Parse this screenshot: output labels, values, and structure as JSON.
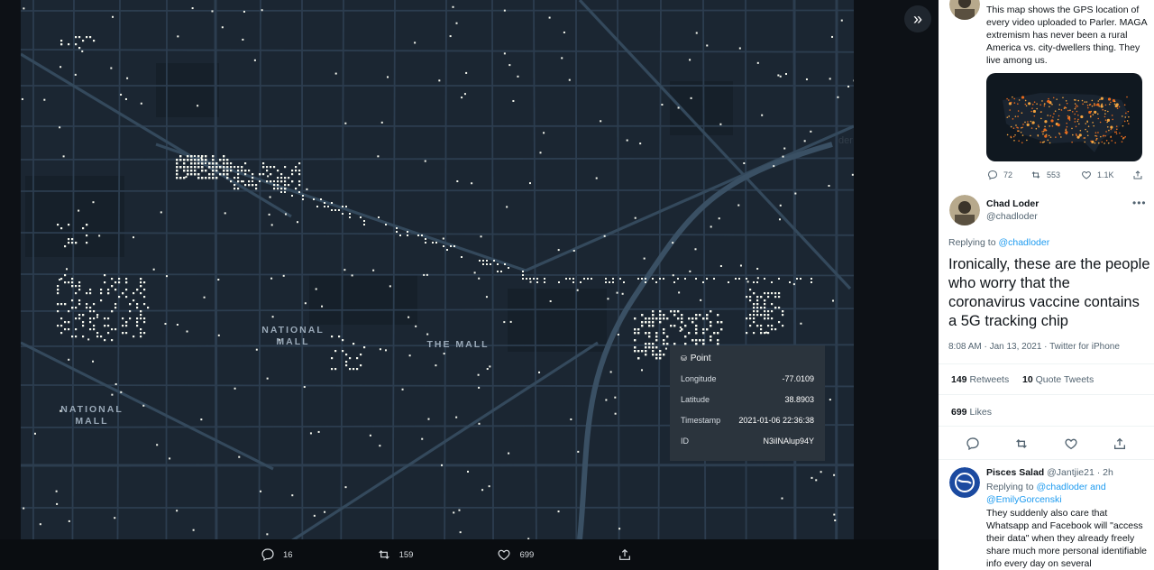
{
  "viewer": {
    "map_labels": [
      {
        "text": "NATIONAL\nMALL"
      },
      {
        "text": "THE MALL"
      },
      {
        "text": "NATIONAL\nMALL"
      }
    ],
    "popup": {
      "title": "Point",
      "rows": [
        {
          "label": "Longitude",
          "value": "-77.0109"
        },
        {
          "label": "Latitude",
          "value": "38.8903"
        },
        {
          "label": "Timestamp",
          "value": "2021-01-06 22:36:38"
        },
        {
          "label": "ID",
          "value": "N3iINAlup94Y"
        }
      ]
    },
    "actions": {
      "replies": "16",
      "retweets": "159",
      "likes": "699"
    }
  },
  "tweets": {
    "top_tweet": {
      "text": "This map shows the GPS location of every video uploaded to Parler. MAGA extremism has never been a rural America vs. city-dwellers thing. They live among us.",
      "replies": "72",
      "retweets": "553",
      "likes": "1.1K"
    },
    "main_tweet": {
      "author": "Chad Loder",
      "handle": "@chadloder",
      "replying_to_label": "Replying to",
      "replying_to": "@chadloder",
      "text": "Ironically, these are the people who worry that the coronavirus vaccine contains a 5G tracking chip",
      "meta": "8:08 AM · Jan 13, 2021 · Twitter for iPhone",
      "retweets_count": "149",
      "retweets_label": "Retweets",
      "quotes_count": "10",
      "quotes_label": "Quote Tweets",
      "likes_count": "699",
      "likes_label": "Likes"
    },
    "reply_tweet": {
      "author": "Pisces Salad",
      "handle": "@Jantjie21 · 2h",
      "replying_to_label": "Replying to",
      "replying_to": "@chadloder and @EmilyGorcenski",
      "text": "They suddenly also care that Whatsapp and Facebook will \"access their data\" when they already freely share much more personal identifiable info every day on several"
    }
  },
  "colors": {
    "accent": "#1d9bf0",
    "map_bg": "#1b2632",
    "road": "#2c3d4f",
    "point": "#f5f7ee"
  }
}
